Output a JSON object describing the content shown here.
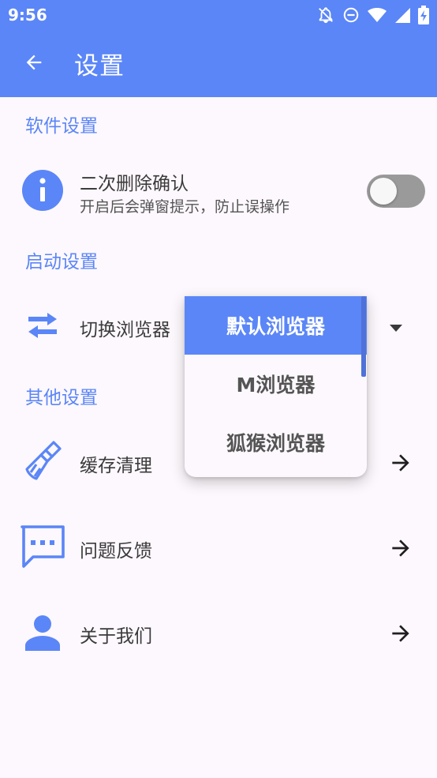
{
  "status_bar": {
    "time": "9:56",
    "icons": [
      "notifications-off-icon",
      "do-not-disturb-icon",
      "wifi-icon",
      "signal-icon",
      "battery-charging-icon"
    ]
  },
  "toolbar": {
    "back_icon": "arrow-left-icon",
    "title": "设置"
  },
  "colors": {
    "primary": "#5b86f7",
    "background": "#fdf8fd",
    "toggle_off": "#9a9a9a"
  },
  "sections": {
    "software": {
      "header": "软件设置",
      "delete_confirm": {
        "title": "二次删除确认",
        "subtitle": "开启后会弹窗提示，防止误操作",
        "icon": "info-icon",
        "enabled": false
      }
    },
    "launch": {
      "header": "启动设置",
      "browser": {
        "label": "切换浏览器",
        "icon": "swap-arrows-icon",
        "options": [
          "默认浏览器",
          "M浏览器",
          "狐猴浏览器"
        ],
        "selected": "默认浏览器"
      }
    },
    "other": {
      "header": "其他设置",
      "items": [
        {
          "label": "缓存清理",
          "icon": "broom-icon"
        },
        {
          "label": "问题反馈",
          "icon": "feedback-chat-icon"
        },
        {
          "label": "关于我们",
          "icon": "person-icon"
        }
      ]
    }
  }
}
